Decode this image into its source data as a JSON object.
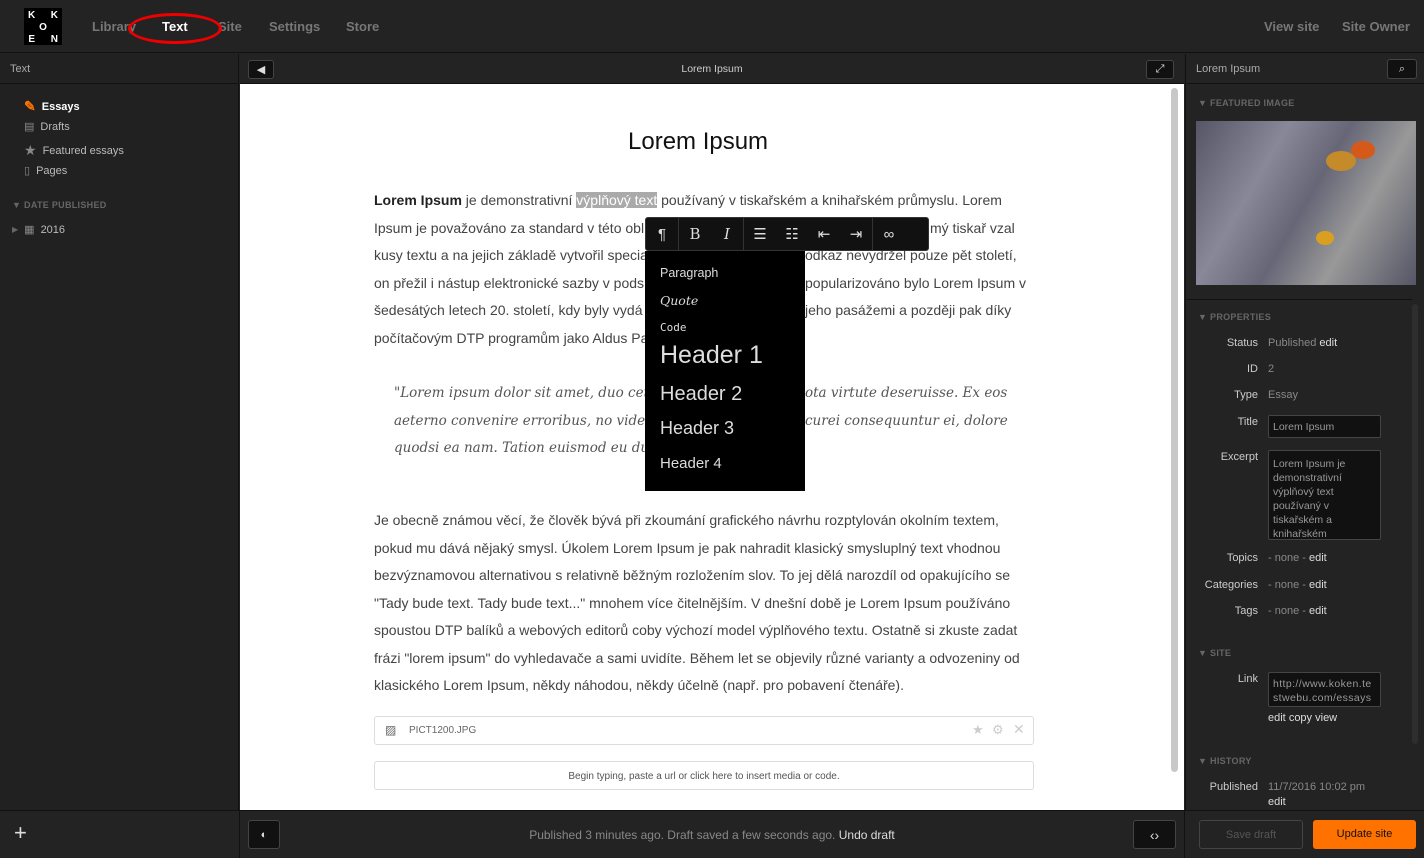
{
  "app": {
    "logo_letters": [
      "K",
      "",
      "K",
      "",
      "O",
      "",
      "E",
      "",
      "N"
    ]
  },
  "nav": {
    "items": [
      "Library",
      "Text",
      "Site",
      "Settings",
      "Store"
    ],
    "active": "Text",
    "right": [
      "View site",
      "Site Owner"
    ]
  },
  "left": {
    "title": "Text",
    "items": [
      {
        "label": "Essays",
        "icon": "pencil-icon",
        "active": true
      },
      {
        "label": "Drafts",
        "icon": "document-icon"
      },
      {
        "label": "Featured essays",
        "icon": "star-icon"
      },
      {
        "label": "Pages",
        "icon": "page-icon"
      }
    ],
    "section": "DATE PUBLISHED",
    "years": [
      "2016"
    ]
  },
  "editor": {
    "header_title": "Lorem Ipsum",
    "doc_title": "Lorem Ipsum",
    "p1": [
      {
        "bold": "Lorem Ipsum",
        "a": " je demonstrativní ",
        "hl": "výplňový text",
        "b": " používaný v tiskařském a knihařském průmyslu. Lorem"
      },
      {
        "l": "Ipsum je považováno za standard v této obl",
        "r": "mý tiskař vzal"
      },
      {
        "l": "kusy textu a na jejich základě vytvořil specia",
        "r": "odkaz nevydržel pouze pět století,"
      },
      {
        "l": "on přežil i nástup elektronické sazby v pods",
        "r": "popularizováno bylo Lorem Ipsum v"
      },
      {
        "l": "šedesátých letech 20. století, kdy byly vydá",
        "r": "jeho pasážemi a později pak díky"
      },
      {
        "l": "počítačovým DTP programům jako Aldus Pa",
        "r": ""
      }
    ],
    "quote": [
      {
        "l": "\"Lorem ipsum dolor sit amet, duo ceteros",
        "r": "ota virtute deseruisse. Ex eos"
      },
      {
        "l": "aeterno convenire erroribus, no vide duis",
        "r": "curei consequuntur ei, dolore"
      },
      {
        "l": "quodsi ea nam. Tation euismod eu duo. S",
        "r": ""
      }
    ],
    "p2": [
      "Je obecně známou věcí, že člověk bývá při zkoumání grafického návrhu rozptylován okolním textem,",
      "pokud mu dává nějaký smysl. Úkolem Lorem Ipsum je pak nahradit klasický smysluplný text vhodnou",
      "bezvýznamovou alternativou s relativně běžným rozložením slov. To jej dělá narozdíl od opakujícího se",
      "\"Tady bude text. Tady bude text...\" mnohem více čitelnějším. V dnešní době je Lorem Ipsum používáno",
      "spoustou DTP balíků a webových editorů coby výchozí model výplňového textu. Ostatně si zkuste zadat",
      "frázi \"lorem ipsum\" do vyhledavače a sami uvidíte. Během let se objevily různé varianty a odvozeniny od",
      "klasického Lorem Ipsum, někdy náhodou, někdy účelně (např. pro pobavení čtenáře)."
    ],
    "media_file": "PICT1200.JPG",
    "insert_placeholder": "Begin typing, paste a url or click here to insert media or code.",
    "toolbar": [
      "pilcrow-icon",
      "bold-icon",
      "italic-icon",
      "bullet-list-icon",
      "numbered-list-icon",
      "outdent-icon",
      "indent-icon",
      "link-icon"
    ],
    "format_menu": [
      "Paragraph",
      "Quote",
      "Code",
      "Header 1",
      "Header 2",
      "Header 3",
      "Header 4"
    ]
  },
  "inspector": {
    "title": "Lorem Ipsum",
    "featured_image": "FEATURED IMAGE",
    "properties": "PROPERTIES",
    "status_label": "Status",
    "status": "Published",
    "edit": "edit",
    "id_label": "ID",
    "id": "2",
    "type_label": "Type",
    "type": "Essay",
    "title_label": "Title",
    "excerpt_label": "Excerpt",
    "excerpt": "Lorem Ipsum je demonstrativní výplňový text používaný v tiskařském a knihařském",
    "topics_label": "Topics",
    "categories_label": "Categories",
    "tags_label": "Tags",
    "none": "- none -",
    "site": "SITE",
    "link_label": "Link",
    "link": "http://www.koken.testwebu.com/essays",
    "copy": "copy",
    "view": "view",
    "history": "HISTORY",
    "published_label": "Published",
    "published": "11/7/2016 10:02 pm"
  },
  "footer": {
    "status": "Published 3 minutes ago. Draft saved a few seconds ago.",
    "undo": "Undo draft",
    "save_draft": "Save draft",
    "update": "Update site"
  },
  "colors": {
    "accent": "#ff7200",
    "annotation": "#e00000"
  }
}
